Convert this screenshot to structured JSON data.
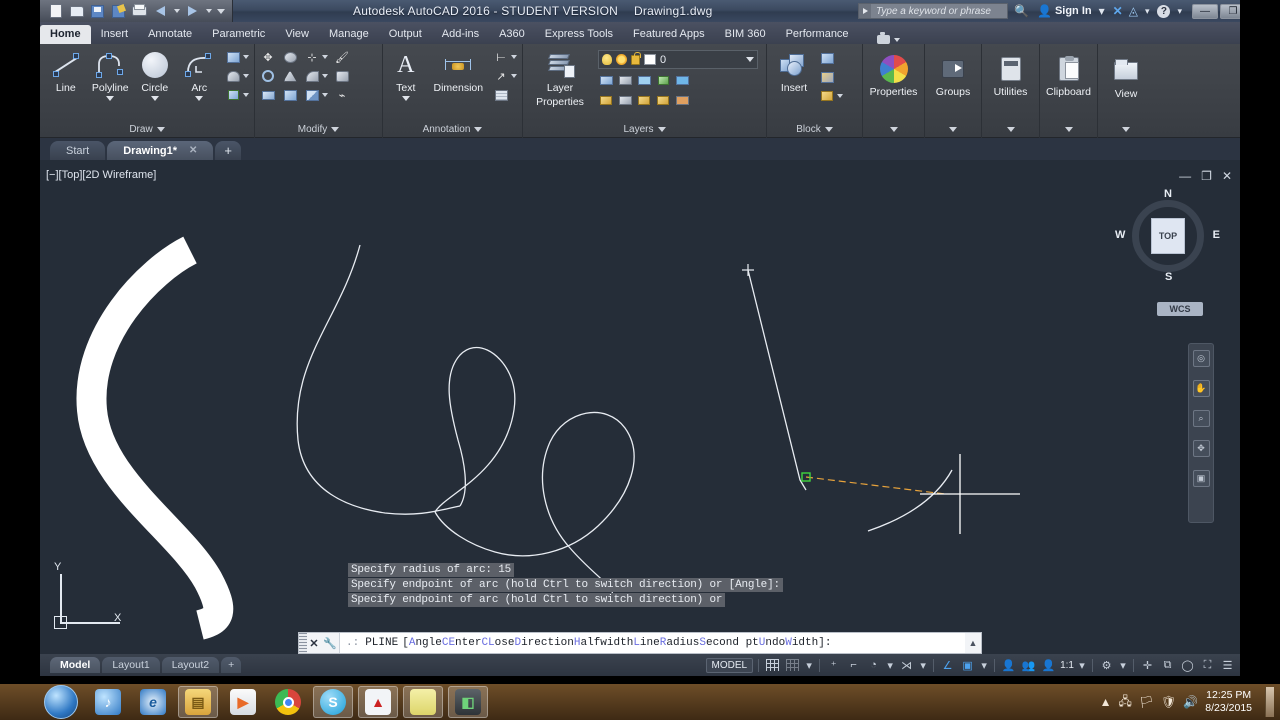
{
  "titlebar": {
    "app_title": "Autodesk AutoCAD 2016 - STUDENT VERSION",
    "file_name": "Drawing1.dwg",
    "search_placeholder": "Type a keyword or phrase",
    "sign_in": "Sign In",
    "minimize": "—",
    "restore": "❐",
    "close": "✕",
    "quick_access": [
      "new-file",
      "open-file",
      "save",
      "save-as",
      "plot",
      "undo",
      "redo",
      "customize"
    ]
  },
  "ribbon": {
    "tabs": [
      {
        "label": "Home",
        "active": true
      },
      {
        "label": "Insert",
        "active": false
      },
      {
        "label": "Annotate",
        "active": false
      },
      {
        "label": "Parametric",
        "active": false
      },
      {
        "label": "View",
        "active": false
      },
      {
        "label": "Manage",
        "active": false
      },
      {
        "label": "Output",
        "active": false
      },
      {
        "label": "Add-ins",
        "active": false
      },
      {
        "label": "A360",
        "active": false
      },
      {
        "label": "Express Tools",
        "active": false
      },
      {
        "label": "Featured Apps",
        "active": false
      },
      {
        "label": "BIM 360",
        "active": false
      },
      {
        "label": "Performance",
        "active": false
      }
    ],
    "panels": {
      "draw": {
        "title": "Draw",
        "tools": [
          {
            "label": "Line",
            "icon": "line-icon"
          },
          {
            "label": "Polyline",
            "icon": "polyline-icon"
          },
          {
            "label": "Circle",
            "icon": "circle-icon"
          },
          {
            "label": "Arc",
            "icon": "arc-icon"
          }
        ]
      },
      "modify": {
        "title": "Modify"
      },
      "annotation": {
        "title": "Annotation",
        "tools": [
          {
            "label": "Text",
            "icon": "text-icon"
          },
          {
            "label": "Dimension",
            "icon": "dimension-icon"
          }
        ]
      },
      "layers": {
        "title": "Layers",
        "layer_properties_label": "Layer\nProperties",
        "layer_properties_line1": "Layer",
        "layer_properties_line2": "Properties",
        "current_layer": "0"
      },
      "block": {
        "title": "Block",
        "insert_label": "Insert"
      },
      "properties": {
        "title": "",
        "label": "Properties"
      },
      "groups": {
        "title": "",
        "label": "Groups"
      },
      "utilities": {
        "title": "",
        "label": "Utilities"
      },
      "clipboard": {
        "title": "",
        "label": "Clipboard"
      },
      "view": {
        "title": "",
        "label": "View"
      }
    }
  },
  "file_tabs": [
    {
      "label": "Start",
      "active": false,
      "closable": false
    },
    {
      "label": "Drawing1*",
      "active": true,
      "closable": true
    },
    {
      "label": "+",
      "active": false,
      "closable": false
    }
  ],
  "canvas": {
    "viewport_label": "[−][Top][2D Wireframe]",
    "viewcube": {
      "top_face": "TOP",
      "north": "N",
      "south": "S",
      "east": "E",
      "west": "W",
      "ucs_label": "WCS"
    },
    "ucs_icon": {
      "x_axis": "X",
      "y_axis": "Y"
    },
    "viewport_controls": [
      "minimize-icon",
      "restore-icon",
      "close-icon"
    ],
    "nav_bar_tools": [
      "steering-wheel-icon",
      "pan-icon",
      "zoom-icon",
      "orbit-icon",
      "showmotion-icon"
    ]
  },
  "command_history": [
    "Specify radius of arc: 15",
    "Specify endpoint of arc (hold Ctrl to switch direction) or [Angle]:",
    "Specify endpoint of arc (hold Ctrl to switch direction) or"
  ],
  "command_line": {
    "prompt_command": "PLINE",
    "open_bracket": "[",
    "close_bracket": "]:",
    "options": [
      {
        "key": "A",
        "rest": "ngle"
      },
      {
        "key": "CE",
        "rest": "nter"
      },
      {
        "key": "CL",
        "rest": "ose"
      },
      {
        "key": "D",
        "rest": "irection"
      },
      {
        "key": "H",
        "rest": "alfwidth"
      },
      {
        "key": "L",
        "rest": "ine"
      },
      {
        "key": "R",
        "rest": "adius"
      },
      {
        "key": "S",
        "rest": "econd pt"
      },
      {
        "key": "U",
        "rest": "ndo"
      },
      {
        "key": "W",
        "rest": "idth"
      }
    ],
    "close_icon": "✕",
    "settings_icon": "wrench-icon",
    "expand_icon": "▲"
  },
  "layout_tabs": [
    {
      "label": "Model",
      "active": true
    },
    {
      "label": "Layout1",
      "active": false
    },
    {
      "label": "Layout2",
      "active": false
    },
    {
      "label": "+",
      "active": false
    }
  ],
  "status_bar": {
    "space_label": "MODEL",
    "scale": "1:1",
    "icons": [
      "grid-display-icon",
      "snap-mode-icon",
      "snap-dropdown-icon",
      "infer-constraints-icon",
      "ortho-mode-icon",
      "polar-tracking-icon",
      "polar-dropdown-icon",
      "object-snap-icon",
      "osnap-dropdown-icon",
      "object-snap-tracking-icon",
      "ucs-icon",
      "ucs-dropdown-icon",
      "annotation-visibility-icon",
      "autoscale-icon",
      "annotation-scale-icon",
      "scale-dropdown-icon",
      "workspace-icon",
      "workspace-dropdown-icon",
      "hardware-accel-icon",
      "isolate-objects-icon",
      "clean-screen-icon",
      "customization-icon"
    ]
  },
  "taskbar": {
    "start_label": "start-orb",
    "apps": [
      {
        "name": "windows-media-player",
        "glyph": "♪",
        "color": "#2f78c4",
        "active": false
      },
      {
        "name": "internet-explorer",
        "glyph": "e",
        "color": "#1f6fb8",
        "active": false
      },
      {
        "name": "file-explorer",
        "glyph": "📁",
        "color": "#e8b84b",
        "active": true
      },
      {
        "name": "media-player",
        "glyph": "▶",
        "color": "#e86a28",
        "active": false
      },
      {
        "name": "google-chrome",
        "glyph": "◉",
        "color": "#d9453c",
        "active": false
      },
      {
        "name": "skype",
        "glyph": "S",
        "color": "#2bb0e8",
        "active": true
      },
      {
        "name": "autocad",
        "glyph": "▲",
        "color": "#cc2222",
        "active": true
      },
      {
        "name": "sticky-notes",
        "glyph": "▢",
        "color": "#e8e26a",
        "active": true
      },
      {
        "name": "camtasia",
        "glyph": "◧",
        "color": "#3a8c46",
        "active": true
      }
    ],
    "tray_icons": [
      "show-hidden-icons",
      "network-icon",
      "action-center-icon",
      "security-icon",
      "volume-icon"
    ],
    "clock_time": "12:25 PM",
    "clock_date": "8/23/2015"
  }
}
